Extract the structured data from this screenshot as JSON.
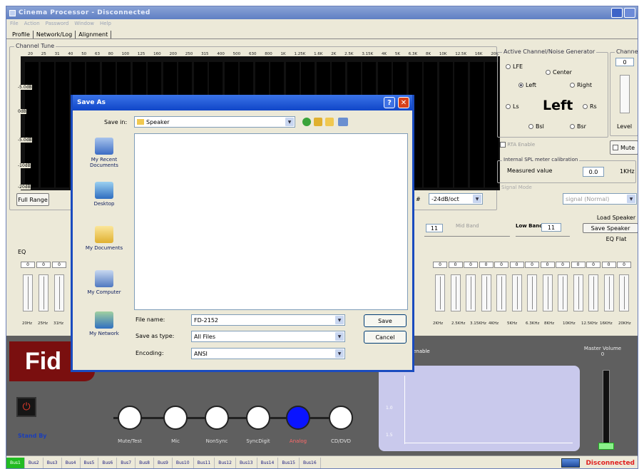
{
  "window": {
    "title": "Cinema Processor - Disconnected"
  },
  "menu": [
    "File",
    "Action",
    "Password",
    "Window",
    "Help"
  ],
  "tabs": [
    "Profile",
    "Network/Log",
    "Alignment"
  ],
  "channel_tune": {
    "title": "Channel Tune",
    "freqs": [
      "20",
      "25",
      "31",
      "40",
      "50",
      "63",
      "80",
      "100",
      "125",
      "160",
      "200",
      "250",
      "315",
      "400",
      "500",
      "630",
      "800",
      "1K",
      "1.25K",
      "1.6K",
      "2K",
      "2.5K",
      "3.15K",
      "4K",
      "5K",
      "6.3K",
      "8K",
      "10K",
      "12.5K",
      "16K",
      "20K"
    ],
    "db_labels": [
      "-5.0dB",
      "0dB",
      "-5.0dB",
      "-10dB",
      "-20dB"
    ],
    "full_range": "Full Range"
  },
  "active_channel": {
    "title": "Active Channel/Noise Generator",
    "options": [
      "LFE",
      "Center",
      "Left",
      "Right",
      "Ls",
      "Rs",
      "Bsl",
      "Bsr"
    ],
    "selected": "Left",
    "display": "Left",
    "rta_enable": "RTA Enable",
    "spl_title": "Internal SPL meter calibration",
    "measured_label": "Measured value",
    "measured_value": "0.0",
    "freq": "1KHz",
    "signal_mode_title": "Signal Mode",
    "signal_mode_value": "signal (Normal)"
  },
  "channel_panel": {
    "title": "Channel",
    "value": "0",
    "level": "Level",
    "mute": "Mute"
  },
  "filters": {
    "slope": "-24dB/oct",
    "mid_band": "Mid Band",
    "low_band": "Low Band",
    "low_value": "11",
    "first_value": "11"
  },
  "speaker_buttons": {
    "load": "Load Speaker",
    "save": "Save Speaker",
    "eq_flat": "EQ Flat"
  },
  "eq": {
    "title": "EQ",
    "value": "0",
    "left_freqs": [
      "20Hz",
      "25Hz",
      "31Hz"
    ],
    "right_freqs": [
      "2.5KHz",
      "3.15KHz",
      "4KHz",
      "5KHz",
      "6.3KHz",
      "8KHz",
      "10KHz",
      "12.5KHz",
      "16KHz",
      "20KHz"
    ],
    "right_first": "2KHz"
  },
  "bottom": {
    "brand": "Fid",
    "standby": "Stand By",
    "sources": [
      "Mute/Test",
      "Mic",
      "NonSync",
      "SyncDigit",
      "Analog",
      "CD/DVD"
    ],
    "active_source": "Analog",
    "enable_label": "enable",
    "master_volume_label": "Master Volume",
    "master_volume_value": "0",
    "lvl_ticks": [
      "1.0",
      "1.5"
    ]
  },
  "status": {
    "buses": [
      "Bus1",
      "Bus2",
      "Bus3",
      "Bus4",
      "Bus5",
      "Bus6",
      "Bus7",
      "Bus8",
      "Bus9",
      "Bus10",
      "Bus11",
      "Bus12",
      "Bus13",
      "Bus14",
      "Bus15",
      "Bus16"
    ],
    "active_bus": "Bus1",
    "connection": "Disconnected"
  },
  "dialog": {
    "title": "Save As",
    "save_in_label": "Save in:",
    "save_in_value": "Speaker",
    "places": [
      "My Recent Documents",
      "Desktop",
      "My Documents",
      "My Computer",
      "My Network"
    ],
    "file_name_label": "File name:",
    "file_name_value": "FD-2152",
    "save_type_label": "Save as type:",
    "save_type_value": "All Files",
    "encoding_label": "Encoding:",
    "encoding_value": "ANSI",
    "save_button": "Save",
    "cancel_button": "Cancel"
  },
  "colors": {
    "accent_blue": "#1046c8",
    "brand_red": "#7a0f0f",
    "active_source": "#0a14ff",
    "status_red": "#e02020"
  }
}
